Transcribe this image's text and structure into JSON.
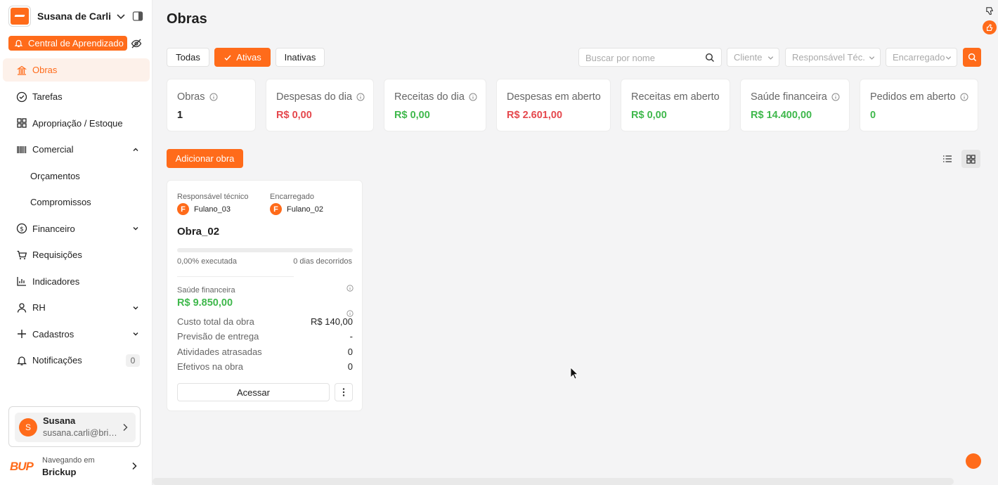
{
  "sidebar": {
    "org_name": "Susana de Carli",
    "learning_center": "Central de Aprendizado",
    "items": [
      {
        "label": "Obras",
        "icon": "building-icon"
      },
      {
        "label": "Tarefas",
        "icon": "check-circle-icon"
      },
      {
        "label": "Apropriação / Estoque",
        "icon": "grid-icon"
      },
      {
        "label": "Comercial",
        "icon": "barcode-icon"
      },
      {
        "label": "Orçamentos"
      },
      {
        "label": "Compromissos"
      },
      {
        "label": "Financeiro",
        "icon": "dollar-icon"
      },
      {
        "label": "Requisições",
        "icon": "cart-icon"
      },
      {
        "label": "Indicadores",
        "icon": "chart-icon"
      },
      {
        "label": "RH",
        "icon": "person-icon"
      },
      {
        "label": "Cadastros",
        "icon": "plus-icon"
      },
      {
        "label": "Notificações",
        "icon": "bell-icon",
        "badge": "0"
      }
    ],
    "user": {
      "initial": "S",
      "name": "Susana",
      "email": "susana.carli@brickup.com.br"
    },
    "brand": {
      "logo": "BUP",
      "label_small": "Navegando em",
      "label": "Brickup"
    }
  },
  "header": {
    "title": "Obras"
  },
  "tabs": [
    {
      "label": "Todas"
    },
    {
      "label": "Ativas"
    },
    {
      "label": "Inativas"
    }
  ],
  "filters": {
    "search_placeholder": "Buscar por nome",
    "cliente": "Cliente",
    "responsavel": "Responsável Téc.",
    "encarregado": "Encarregado"
  },
  "stats": [
    {
      "label": "Obras",
      "value": "1",
      "info": true
    },
    {
      "label": "Despesas do dia",
      "value": "R$ 0,00",
      "info": true
    },
    {
      "label": "Receitas do dia",
      "value": "R$ 0,00",
      "info": true
    },
    {
      "label": "Despesas em aberto",
      "value": "R$ 2.601,00",
      "info": false
    },
    {
      "label": "Receitas em aberto",
      "value": "R$ 0,00",
      "info": false
    },
    {
      "label": "Saúde financeira",
      "value": "R$ 14.400,00",
      "info": true
    },
    {
      "label": "Pedidos em aberto",
      "value": "0",
      "info": true
    }
  ],
  "add_button": "Adicionar obra",
  "card": {
    "resp_label": "Responsável técnico",
    "resp_initial": "F",
    "resp_name": "Fulano_03",
    "enc_label": "Encarregado",
    "enc_initial": "F",
    "enc_name": "Fulano_02",
    "title": "Obra_02",
    "progress_fraction": 0.0,
    "executed": "0,00% executada",
    "days": "0 dias decorridos",
    "health_label": "Saúde financeira",
    "health_value": "R$ 9.850,00",
    "rows": [
      {
        "label": "Custo total da obra",
        "value": "R$ 140,00"
      },
      {
        "label": "Previsão de entrega",
        "value": "-"
      },
      {
        "label": "Atividades atrasadas",
        "value": "0"
      },
      {
        "label": "Efetivos na obra",
        "value": "0"
      }
    ],
    "access": "Acessar"
  },
  "colors": {
    "accent": "#ff6b1a",
    "negative": "#e5484d",
    "positive": "#3fb84c"
  }
}
